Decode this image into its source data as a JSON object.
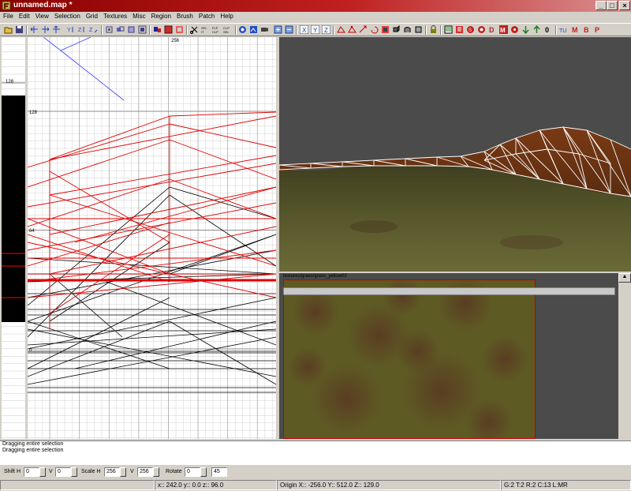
{
  "window": {
    "title": "unnamed.map *"
  },
  "menu": [
    "File",
    "Edit",
    "View",
    "Selection",
    "Grid",
    "Textures",
    "Misc",
    "Region",
    "Brush",
    "Patch",
    "Help"
  ],
  "zview": {
    "labels": [
      "128"
    ]
  },
  "xyview": {
    "labels": {
      "top_left": "128",
      "top_mid": "256",
      "left_top": "128",
      "left_mid": "64",
      "left_bottom": "0"
    }
  },
  "texture_browser": {
    "texture_name": "textures/grass/grass_yellow02"
  },
  "console": {
    "lines": [
      "Dragging entire selection",
      "Dragging entire selection"
    ]
  },
  "surface": {
    "shift_h_label": "Shift H",
    "shift_h": "0",
    "shift_v_label": "V",
    "shift_v": "0",
    "scale_h_label": "Scale H",
    "scale_h": "256",
    "scale_v_label": "V",
    "scale_v": "256",
    "rotate_label": "Rotate",
    "rotate": "0",
    "rotate_step": "45"
  },
  "status": {
    "coords": "x:: 242.0  y:: 0.0  z:: 96.0",
    "origin": "Origin X:: -256.0  Y:: 512.0  Z:: 129.0",
    "grid": "G:2 T:2 R:2 C:13 L:MR"
  },
  "icons": {
    "app": "radiant-app-icon"
  },
  "colors": {
    "titlebar": "#8a0000",
    "selected_wire": "#ff0000",
    "camera_bg": "#4b4b4b"
  }
}
